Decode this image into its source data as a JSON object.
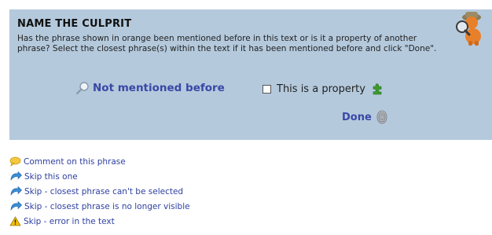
{
  "panel": {
    "title": "NAME THE CULPRIT",
    "instructions": "Has the phrase shown in orange been mentioned before in this text or is it a property of another phrase? Select the closest phrase(s) within the text if it has been mentioned before and click \"Done\".",
    "not_mentioned_label": "Not mentioned before",
    "property_label": "This is a property",
    "property_checked": false,
    "done_label": "Done"
  },
  "links": [
    {
      "icon": "speech-bubble-icon",
      "label": "Comment on this phrase"
    },
    {
      "icon": "skip-arrow-icon",
      "label": "Skip this one"
    },
    {
      "icon": "skip-arrow-icon",
      "label": "Skip - closest phrase can't be selected"
    },
    {
      "icon": "skip-arrow-icon",
      "label": "Skip - closest phrase is no longer visible"
    },
    {
      "icon": "warning-icon",
      "label": "Skip - error in the text"
    }
  ],
  "colors": {
    "panel_bg": "#b4c9dc",
    "link_blue": "#3a47a6",
    "puzzle_green": "#3c9a2e",
    "warning_yellow": "#f2c200"
  }
}
